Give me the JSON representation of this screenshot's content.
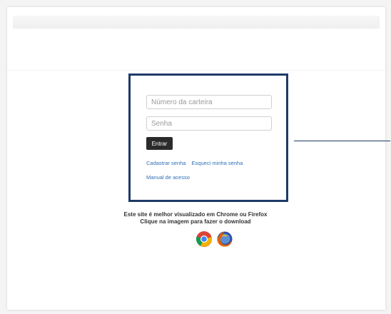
{
  "login": {
    "card_number_placeholder": "Número da carteira",
    "password_placeholder": "Senha",
    "submit_label": "Entrar",
    "register_link": "Cadastrar senha",
    "forgot_link": "Esqueci minha senha",
    "manual_link": "Manual de acesso"
  },
  "notice": {
    "line1": "Este site é melhor visualizado em Chrome ou Firefox",
    "line2": "Clique na imagem para fazer o download"
  },
  "browsers": [
    {
      "name": "chrome-icon"
    },
    {
      "name": "firefox-icon"
    }
  ],
  "colors": {
    "box_border": "#1f3a68",
    "link": "#2f6eb5",
    "button": "#2b2b2b"
  }
}
